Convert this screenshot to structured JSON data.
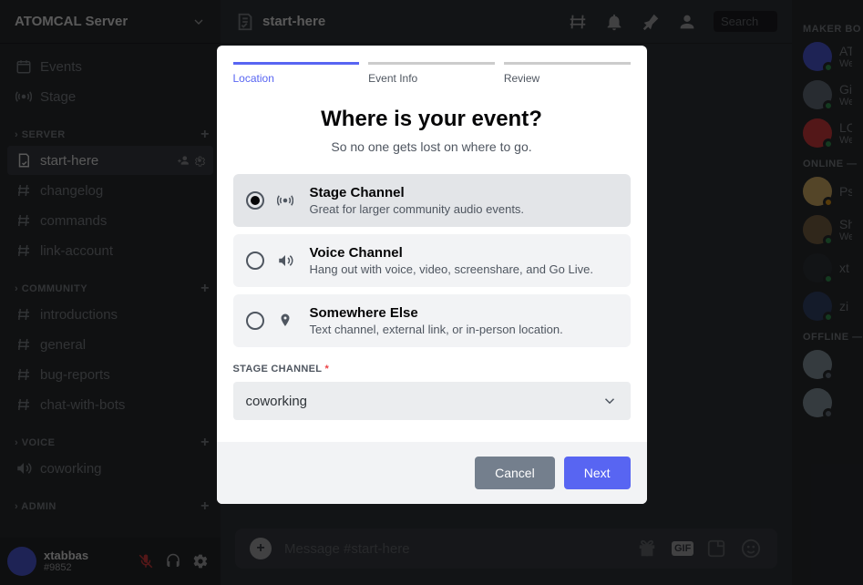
{
  "server": {
    "name": "ATOMCAL Server"
  },
  "topChannels": [
    {
      "icon": "calendar",
      "label": "Events"
    },
    {
      "icon": "stage",
      "label": "Stage"
    }
  ],
  "sections": [
    {
      "name": "SERVER",
      "channels": [
        {
          "icon": "rules",
          "label": "start-here",
          "active": true
        },
        {
          "icon": "hash",
          "label": "changelog"
        },
        {
          "icon": "hash",
          "label": "commands"
        },
        {
          "icon": "hash",
          "label": "link-account"
        }
      ]
    },
    {
      "name": "COMMUNITY",
      "channels": [
        {
          "icon": "hash",
          "label": "introductions"
        },
        {
          "icon": "hash",
          "label": "general"
        },
        {
          "icon": "hash",
          "label": "bug-reports"
        },
        {
          "icon": "hash",
          "label": "chat-with-bots"
        }
      ]
    },
    {
      "name": "VOICE",
      "channels": [
        {
          "icon": "speaker",
          "label": "coworking"
        }
      ]
    },
    {
      "name": "ADMIN",
      "channels": []
    }
  ],
  "user": {
    "name": "xtabbas",
    "tag": "#9852"
  },
  "header": {
    "channelIcon": "rules",
    "title": "start-here",
    "searchPlaceholder": "Search"
  },
  "messageInput": {
    "placeholder": "Message #start-here"
  },
  "memberGroups": [
    {
      "title": "MAKER BO",
      "members": [
        {
          "name": "AT",
          "sub": "We",
          "status": "#3ba55d",
          "color": "#5865f2"
        },
        {
          "name": "Gi",
          "sub": "We",
          "status": "#3ba55d",
          "color": "#747f8d"
        },
        {
          "name": "LC",
          "sub": "We",
          "status": "#3ba55d",
          "color": "#ed4245"
        }
      ]
    },
    {
      "title": "ONLINE —",
      "members": [
        {
          "name": "Ps",
          "sub": "",
          "status": "#faa81a",
          "color": "#f0c674"
        },
        {
          "name": "Sh",
          "sub": "We",
          "status": "#3ba55d",
          "color": "#8b6f4e"
        },
        {
          "name": "xt",
          "sub": "",
          "status": "#3ba55d",
          "color": "#36393f"
        },
        {
          "name": "zi",
          "sub": "",
          "status": "#3ba55d",
          "color": "#3b4d7a"
        }
      ]
    },
    {
      "title": "OFFLINE —",
      "members": [
        {
          "name": "",
          "sub": "",
          "status": "#747f8d",
          "color": "#99aab5"
        },
        {
          "name": "",
          "sub": "",
          "status": "#747f8d",
          "color": "#99aab5"
        }
      ]
    }
  ],
  "modal": {
    "steps": [
      {
        "label": "Location",
        "active": true
      },
      {
        "label": "Event Info",
        "active": false
      },
      {
        "label": "Review",
        "active": false
      }
    ],
    "title": "Where is your event?",
    "subtitle": "So no one gets lost on where to go.",
    "options": [
      {
        "id": "stage",
        "title": "Stage Channel",
        "desc": "Great for larger community audio events.",
        "icon": "stage",
        "selected": true
      },
      {
        "id": "voice",
        "title": "Voice Channel",
        "desc": "Hang out with voice, video, screenshare, and Go Live.",
        "icon": "speaker",
        "selected": false
      },
      {
        "id": "else",
        "title": "Somewhere Else",
        "desc": "Text channel, external link, or in-person location.",
        "icon": "pin",
        "selected": false
      }
    ],
    "selectLabel": "STAGE CHANNEL",
    "selectValue": "coworking",
    "cancelLabel": "Cancel",
    "nextLabel": "Next"
  }
}
